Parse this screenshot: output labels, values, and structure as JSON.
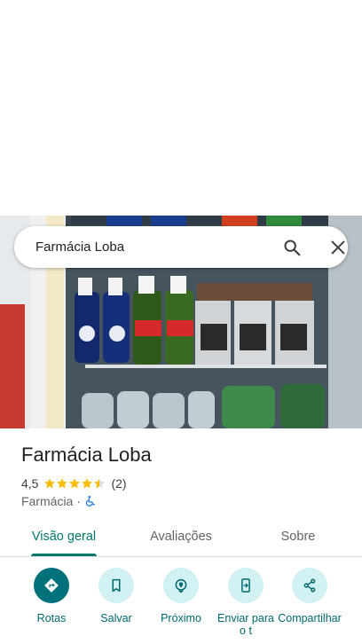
{
  "search": {
    "query": "Farmácia Loba"
  },
  "place": {
    "title": "Farmácia Loba",
    "rating": "4,5",
    "stars": 4.5,
    "reviews": "(2)",
    "category": "Farmácia",
    "separator": "·"
  },
  "tabs": [
    {
      "label": "Visão geral",
      "active": true
    },
    {
      "label": "Avaliações",
      "active": false
    },
    {
      "label": "Sobre",
      "active": false
    }
  ],
  "actions": [
    {
      "label": "Rotas",
      "icon": "directions-icon"
    },
    {
      "label": "Salvar",
      "icon": "bookmark-icon"
    },
    {
      "label": "Próximo",
      "icon": "nearby-icon"
    },
    {
      "label": "Enviar para o t",
      "icon": "send-to-phone-icon"
    },
    {
      "label": "Compartilhar",
      "icon": "share-icon"
    }
  ],
  "colors": {
    "accent": "#00796b",
    "action_bg": "#d2f1f3",
    "primary_action_bg": "#00707a",
    "star": "#fbbc04"
  }
}
